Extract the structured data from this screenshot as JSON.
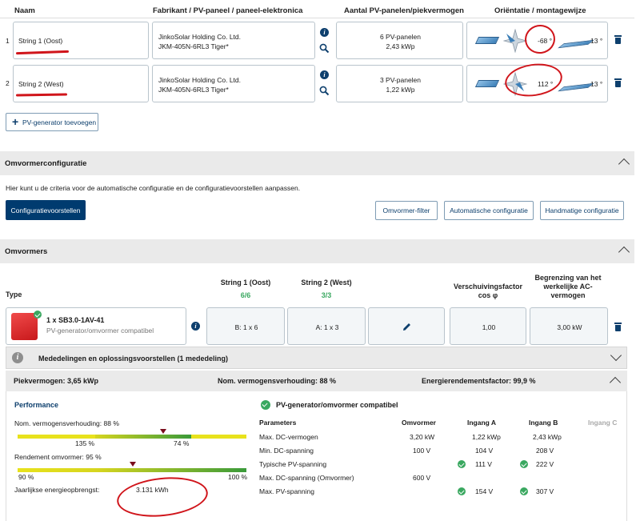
{
  "table": {
    "headers": [
      "Naam",
      "Fabrikant / PV-paneel / paneel-elektronica",
      "Aantal PV-panelen/piekvermogen",
      "Oriëntatie / montagewijze"
    ],
    "rows": [
      {
        "num": "1",
        "name": "String 1 (Oost)",
        "manufacturer": "JinkoSolar Holding Co. Ltd.",
        "panel": "JKM-405N-6RL3 Tiger*",
        "count": "6 PV-panelen",
        "power": "2,43 kWp",
        "azimuth": "-68 °",
        "tilt": "13 °"
      },
      {
        "num": "2",
        "name": "String 2 (West)",
        "manufacturer": "JinkoSolar Holding Co. Ltd.",
        "panel": "JKM-405N-6RL3 Tiger*",
        "count": "3 PV-panelen",
        "power": "1,22 kWp",
        "azimuth": "112 °",
        "tilt": "13 °"
      }
    ],
    "add_button": "PV-generator toevoegen"
  },
  "config": {
    "title": "Omvormerconfiguratie",
    "description": "Hier kunt u de criteria voor de automatische configuratie en de configuratievoorstellen aanpassen.",
    "primary_button": "Configuratievoorstellen",
    "buttons": [
      "Omvormer-filter",
      "Automatische configuratie",
      "Handmatige configuratie"
    ]
  },
  "inverters": {
    "title": "Omvormers",
    "type_label": "Type",
    "col_string1": "String 1 (Oost)",
    "col_string1_count": "6/6",
    "col_string2": "String 2 (West)",
    "col_string2_count": "3/3",
    "col_cos_line1": "Verschuivingsfactor",
    "col_cos_line2": "cos φ",
    "col_limit_line1": "Begrenzing van het",
    "col_limit_line2": "werkelijke AC-",
    "col_limit_line3": "vermogen",
    "device_name": "1 x SB3.0-1AV-41",
    "device_status": "PV-generator/omvormer compatibel",
    "string1_value": "B: 1 x 6",
    "string2_value": "A: 1 x 3",
    "cos_value": "1,00",
    "limit_value": "3,00 kW",
    "messages": "Mededelingen en oplossingsvoorstellen (1 mededeling)",
    "peak": "Piekvermogen: 3,65 kWp",
    "ratio": "Nom. vermogensverhouding: 88 %",
    "yield_factor": "Energierendementsfactor: 99,9 %"
  },
  "performance": {
    "title": "Performance",
    "nom_label": "Nom. vermogensverhouding: 88 %",
    "nom_tick_left": "135 %",
    "nom_tick_right": "74 %",
    "nom_level": 0.88,
    "eff_label": "Rendement omvormer: 95 %",
    "eff_tick_left": "90 %",
    "eff_tick_right": "100 %",
    "eff_level": 0.95,
    "yearly_label": "Jaarlijkse energieopbrengst:",
    "yearly_value": "3.131 kWh"
  },
  "compat": {
    "title": "PV-generator/omvormer compatibel",
    "headers": [
      "Parameters",
      "Omvormer",
      "Ingang A",
      "Ingang B",
      "Ingang C"
    ],
    "rows": [
      {
        "param": "Max. DC-vermogen",
        "inverter": "3,20 kW",
        "a": "1,22 kWp",
        "b": "2,43 kWp",
        "check": false
      },
      {
        "param": "Min. DC-spanning",
        "inverter": "100 V",
        "a": "104 V",
        "b": "208 V",
        "check": false
      },
      {
        "param": "Typische PV-spanning",
        "inverter": "",
        "a": "111 V",
        "b": "222 V",
        "check": true
      },
      {
        "param": "Max. DC-spanning (Omvormer)",
        "inverter": "600 V",
        "a": "",
        "b": "",
        "check": false
      },
      {
        "param": "Max. PV-spanning",
        "inverter": "",
        "a": "154 V",
        "b": "307 V",
        "check": true
      }
    ]
  },
  "colors": {
    "primary": "#003b6f",
    "accent_green": "#3aa860",
    "annotation_red": "#d0151b"
  }
}
